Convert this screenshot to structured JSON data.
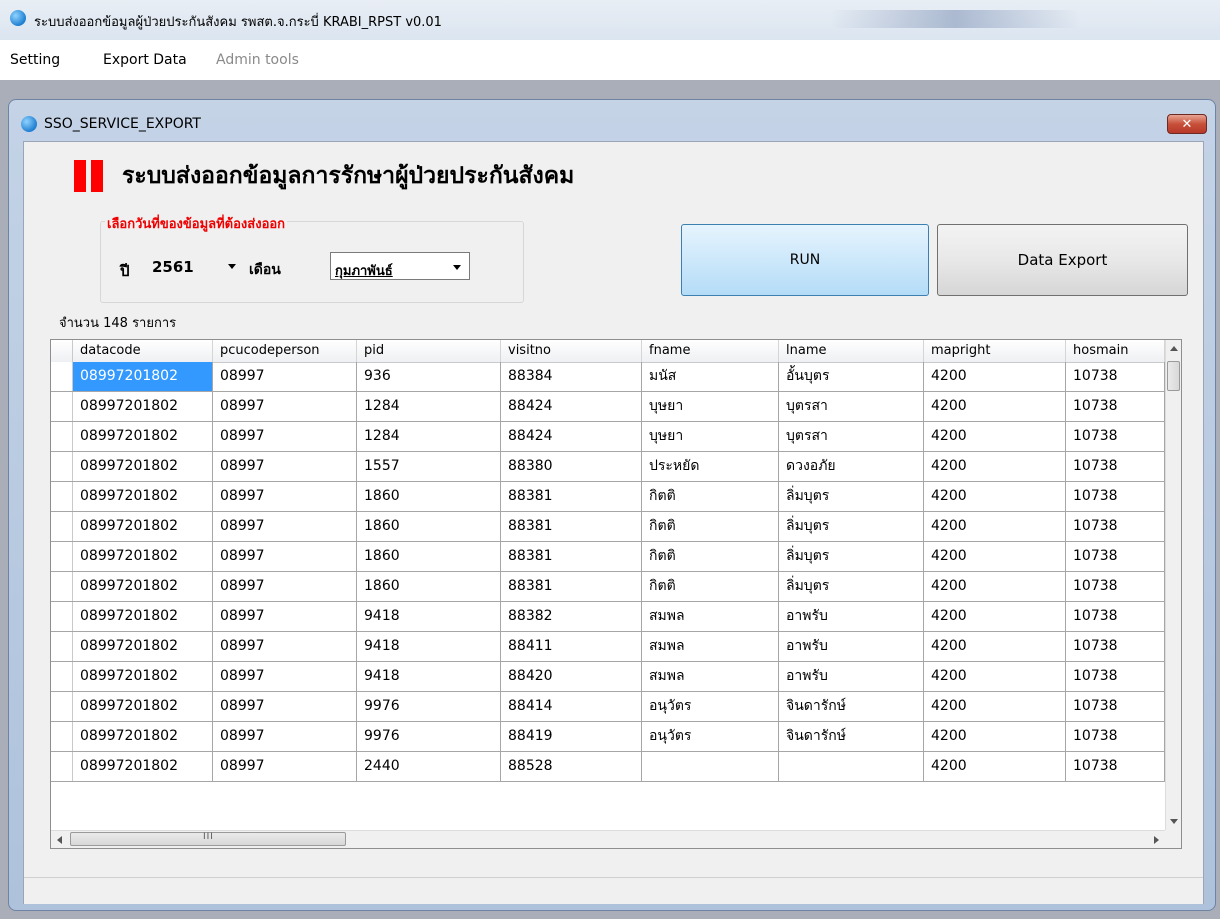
{
  "app": {
    "title": "ระบบส่งออกข้อมูลผู้ป่วยประกันสังคม รพสต.จ.กระบี่ KRABI_RPST v0.01"
  },
  "menu": {
    "items": [
      "Setting",
      "Export Data",
      "Admin tools"
    ],
    "disabled": [
      false,
      false,
      true
    ]
  },
  "window": {
    "title": "SSO_SERVICE_EXPORT",
    "close_glyph": "✕"
  },
  "form": {
    "heading": "ระบบส่งออกข้อมูลการรักษาผู้ป่วยประกันสังคม",
    "group_title": "เลือกวันที่ของข้อมูลที่ต้องส่งออก",
    "year_label": "ปี",
    "year_value": "2561",
    "month_label": "เดือน",
    "month_value": "กุมภาพันธ์",
    "run_label": "RUN",
    "export_label": "Data Export",
    "count_text": "จำนวน 148 รายการ"
  },
  "colors": {
    "accent_red": "#ff0000",
    "selection": "#3399ff"
  },
  "grid": {
    "columns": [
      "datacode",
      "pcucodeperson",
      "pid",
      "visitno",
      "fname",
      "lname",
      "mapright",
      "hosmain"
    ],
    "rows": [
      [
        "08997201802",
        "08997",
        "936",
        "88384",
        "มนัส",
        "อั้นบุตร",
        "4200",
        "10738"
      ],
      [
        "08997201802",
        "08997",
        "1284",
        "88424",
        "บุษยา",
        "บุตรสา",
        "4200",
        "10738"
      ],
      [
        "08997201802",
        "08997",
        "1284",
        "88424",
        "บุษยา",
        "บุตรสา",
        "4200",
        "10738"
      ],
      [
        "08997201802",
        "08997",
        "1557",
        "88380",
        "ประหยัด",
        "ดวงอภัย",
        "4200",
        "10738"
      ],
      [
        "08997201802",
        "08997",
        "1860",
        "88381",
        "กิตติ",
        "ลิ่มบุตร",
        "4200",
        "10738"
      ],
      [
        "08997201802",
        "08997",
        "1860",
        "88381",
        "กิตติ",
        "ลิ่มบุตร",
        "4200",
        "10738"
      ],
      [
        "08997201802",
        "08997",
        "1860",
        "88381",
        "กิตติ",
        "ลิ่มบุตร",
        "4200",
        "10738"
      ],
      [
        "08997201802",
        "08997",
        "1860",
        "88381",
        "กิตติ",
        "ลิ่มบุตร",
        "4200",
        "10738"
      ],
      [
        "08997201802",
        "08997",
        "9418",
        "88382",
        "สมพล",
        "อาพรับ",
        "4200",
        "10738"
      ],
      [
        "08997201802",
        "08997",
        "9418",
        "88411",
        "สมพล",
        "อาพรับ",
        "4200",
        "10738"
      ],
      [
        "08997201802",
        "08997",
        "9418",
        "88420",
        "สมพล",
        "อาพรับ",
        "4200",
        "10738"
      ],
      [
        "08997201802",
        "08997",
        "9976",
        "88414",
        "อนุวัตร",
        "จินดารักษ์",
        "4200",
        "10738"
      ],
      [
        "08997201802",
        "08997",
        "9976",
        "88419",
        "อนุวัตร",
        "จินดารักษ์",
        "4200",
        "10738"
      ],
      [
        "08997201802",
        "08997",
        "2440",
        "88528",
        "",
        "",
        "4200",
        "10738"
      ]
    ]
  }
}
